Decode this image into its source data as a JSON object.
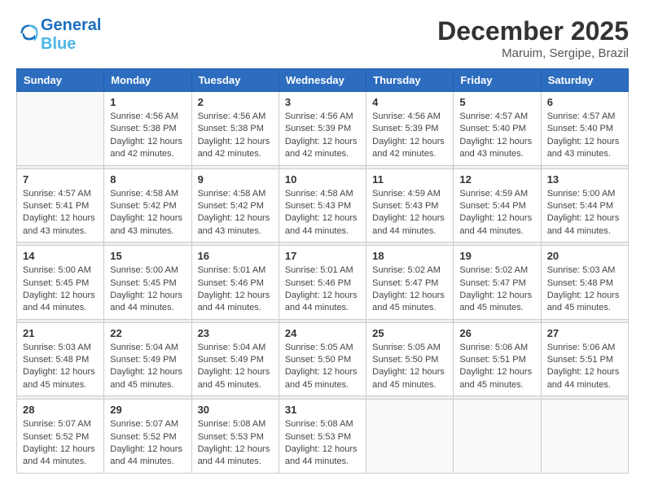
{
  "header": {
    "logo_line1": "General",
    "logo_line2": "Blue",
    "month": "December 2025",
    "location": "Maruim, Sergipe, Brazil"
  },
  "weekdays": [
    "Sunday",
    "Monday",
    "Tuesday",
    "Wednesday",
    "Thursday",
    "Friday",
    "Saturday"
  ],
  "weeks": [
    [
      {
        "day": "",
        "sunrise": "",
        "sunset": "",
        "daylight": ""
      },
      {
        "day": "1",
        "sunrise": "Sunrise: 4:56 AM",
        "sunset": "Sunset: 5:38 PM",
        "daylight": "Daylight: 12 hours and 42 minutes."
      },
      {
        "day": "2",
        "sunrise": "Sunrise: 4:56 AM",
        "sunset": "Sunset: 5:38 PM",
        "daylight": "Daylight: 12 hours and 42 minutes."
      },
      {
        "day": "3",
        "sunrise": "Sunrise: 4:56 AM",
        "sunset": "Sunset: 5:39 PM",
        "daylight": "Daylight: 12 hours and 42 minutes."
      },
      {
        "day": "4",
        "sunrise": "Sunrise: 4:56 AM",
        "sunset": "Sunset: 5:39 PM",
        "daylight": "Daylight: 12 hours and 42 minutes."
      },
      {
        "day": "5",
        "sunrise": "Sunrise: 4:57 AM",
        "sunset": "Sunset: 5:40 PM",
        "daylight": "Daylight: 12 hours and 43 minutes."
      },
      {
        "day": "6",
        "sunrise": "Sunrise: 4:57 AM",
        "sunset": "Sunset: 5:40 PM",
        "daylight": "Daylight: 12 hours and 43 minutes."
      }
    ],
    [
      {
        "day": "7",
        "sunrise": "Sunrise: 4:57 AM",
        "sunset": "Sunset: 5:41 PM",
        "daylight": "Daylight: 12 hours and 43 minutes."
      },
      {
        "day": "8",
        "sunrise": "Sunrise: 4:58 AM",
        "sunset": "Sunset: 5:42 PM",
        "daylight": "Daylight: 12 hours and 43 minutes."
      },
      {
        "day": "9",
        "sunrise": "Sunrise: 4:58 AM",
        "sunset": "Sunset: 5:42 PM",
        "daylight": "Daylight: 12 hours and 43 minutes."
      },
      {
        "day": "10",
        "sunrise": "Sunrise: 4:58 AM",
        "sunset": "Sunset: 5:43 PM",
        "daylight": "Daylight: 12 hours and 44 minutes."
      },
      {
        "day": "11",
        "sunrise": "Sunrise: 4:59 AM",
        "sunset": "Sunset: 5:43 PM",
        "daylight": "Daylight: 12 hours and 44 minutes."
      },
      {
        "day": "12",
        "sunrise": "Sunrise: 4:59 AM",
        "sunset": "Sunset: 5:44 PM",
        "daylight": "Daylight: 12 hours and 44 minutes."
      },
      {
        "day": "13",
        "sunrise": "Sunrise: 5:00 AM",
        "sunset": "Sunset: 5:44 PM",
        "daylight": "Daylight: 12 hours and 44 minutes."
      }
    ],
    [
      {
        "day": "14",
        "sunrise": "Sunrise: 5:00 AM",
        "sunset": "Sunset: 5:45 PM",
        "daylight": "Daylight: 12 hours and 44 minutes."
      },
      {
        "day": "15",
        "sunrise": "Sunrise: 5:00 AM",
        "sunset": "Sunset: 5:45 PM",
        "daylight": "Daylight: 12 hours and 44 minutes."
      },
      {
        "day": "16",
        "sunrise": "Sunrise: 5:01 AM",
        "sunset": "Sunset: 5:46 PM",
        "daylight": "Daylight: 12 hours and 44 minutes."
      },
      {
        "day": "17",
        "sunrise": "Sunrise: 5:01 AM",
        "sunset": "Sunset: 5:46 PM",
        "daylight": "Daylight: 12 hours and 44 minutes."
      },
      {
        "day": "18",
        "sunrise": "Sunrise: 5:02 AM",
        "sunset": "Sunset: 5:47 PM",
        "daylight": "Daylight: 12 hours and 45 minutes."
      },
      {
        "day": "19",
        "sunrise": "Sunrise: 5:02 AM",
        "sunset": "Sunset: 5:47 PM",
        "daylight": "Daylight: 12 hours and 45 minutes."
      },
      {
        "day": "20",
        "sunrise": "Sunrise: 5:03 AM",
        "sunset": "Sunset: 5:48 PM",
        "daylight": "Daylight: 12 hours and 45 minutes."
      }
    ],
    [
      {
        "day": "21",
        "sunrise": "Sunrise: 5:03 AM",
        "sunset": "Sunset: 5:48 PM",
        "daylight": "Daylight: 12 hours and 45 minutes."
      },
      {
        "day": "22",
        "sunrise": "Sunrise: 5:04 AM",
        "sunset": "Sunset: 5:49 PM",
        "daylight": "Daylight: 12 hours and 45 minutes."
      },
      {
        "day": "23",
        "sunrise": "Sunrise: 5:04 AM",
        "sunset": "Sunset: 5:49 PM",
        "daylight": "Daylight: 12 hours and 45 minutes."
      },
      {
        "day": "24",
        "sunrise": "Sunrise: 5:05 AM",
        "sunset": "Sunset: 5:50 PM",
        "daylight": "Daylight: 12 hours and 45 minutes."
      },
      {
        "day": "25",
        "sunrise": "Sunrise: 5:05 AM",
        "sunset": "Sunset: 5:50 PM",
        "daylight": "Daylight: 12 hours and 45 minutes."
      },
      {
        "day": "26",
        "sunrise": "Sunrise: 5:06 AM",
        "sunset": "Sunset: 5:51 PM",
        "daylight": "Daylight: 12 hours and 45 minutes."
      },
      {
        "day": "27",
        "sunrise": "Sunrise: 5:06 AM",
        "sunset": "Sunset: 5:51 PM",
        "daylight": "Daylight: 12 hours and 44 minutes."
      }
    ],
    [
      {
        "day": "28",
        "sunrise": "Sunrise: 5:07 AM",
        "sunset": "Sunset: 5:52 PM",
        "daylight": "Daylight: 12 hours and 44 minutes."
      },
      {
        "day": "29",
        "sunrise": "Sunrise: 5:07 AM",
        "sunset": "Sunset: 5:52 PM",
        "daylight": "Daylight: 12 hours and 44 minutes."
      },
      {
        "day": "30",
        "sunrise": "Sunrise: 5:08 AM",
        "sunset": "Sunset: 5:53 PM",
        "daylight": "Daylight: 12 hours and 44 minutes."
      },
      {
        "day": "31",
        "sunrise": "Sunrise: 5:08 AM",
        "sunset": "Sunset: 5:53 PM",
        "daylight": "Daylight: 12 hours and 44 minutes."
      },
      {
        "day": "",
        "sunrise": "",
        "sunset": "",
        "daylight": ""
      },
      {
        "day": "",
        "sunrise": "",
        "sunset": "",
        "daylight": ""
      },
      {
        "day": "",
        "sunrise": "",
        "sunset": "",
        "daylight": ""
      }
    ]
  ]
}
